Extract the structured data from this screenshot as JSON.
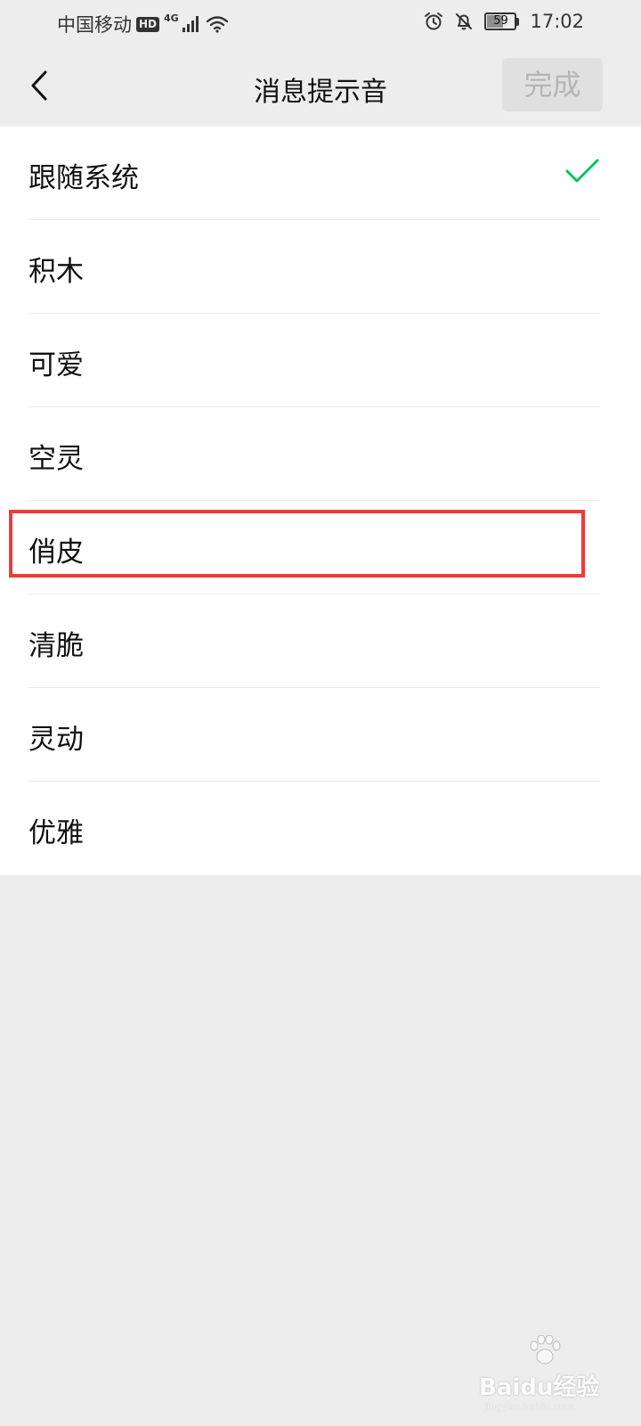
{
  "status_bar": {
    "carrier": "中国移动",
    "hd_badge": "HD",
    "network": "4G",
    "battery_level": "59",
    "time": "17:02",
    "icons": [
      "signal-icon",
      "wifi-icon",
      "alarm-icon",
      "bell-off-icon",
      "battery-icon"
    ]
  },
  "header": {
    "back_icon": "chevron-left-icon",
    "title": "消息提示音",
    "done_label": "完成"
  },
  "sound_options": [
    {
      "label": "跟随系统",
      "selected": true
    },
    {
      "label": "积木",
      "selected": false
    },
    {
      "label": "可爱",
      "selected": false
    },
    {
      "label": "空灵",
      "selected": false
    },
    {
      "label": "俏皮",
      "selected": false,
      "highlighted": true
    },
    {
      "label": "清脆",
      "selected": false
    },
    {
      "label": "灵动",
      "selected": false
    },
    {
      "label": "优雅",
      "selected": false
    }
  ],
  "watermark": {
    "brand": "Baidu经验",
    "url": "jingyan.baidu.com"
  },
  "colors": {
    "background": "#ededed",
    "list_background": "#ffffff",
    "check": "#07c160",
    "highlight": "#ef3a3a",
    "done_disabled_bg": "#e0e0e0",
    "done_disabled_text": "#b5b5b5"
  }
}
